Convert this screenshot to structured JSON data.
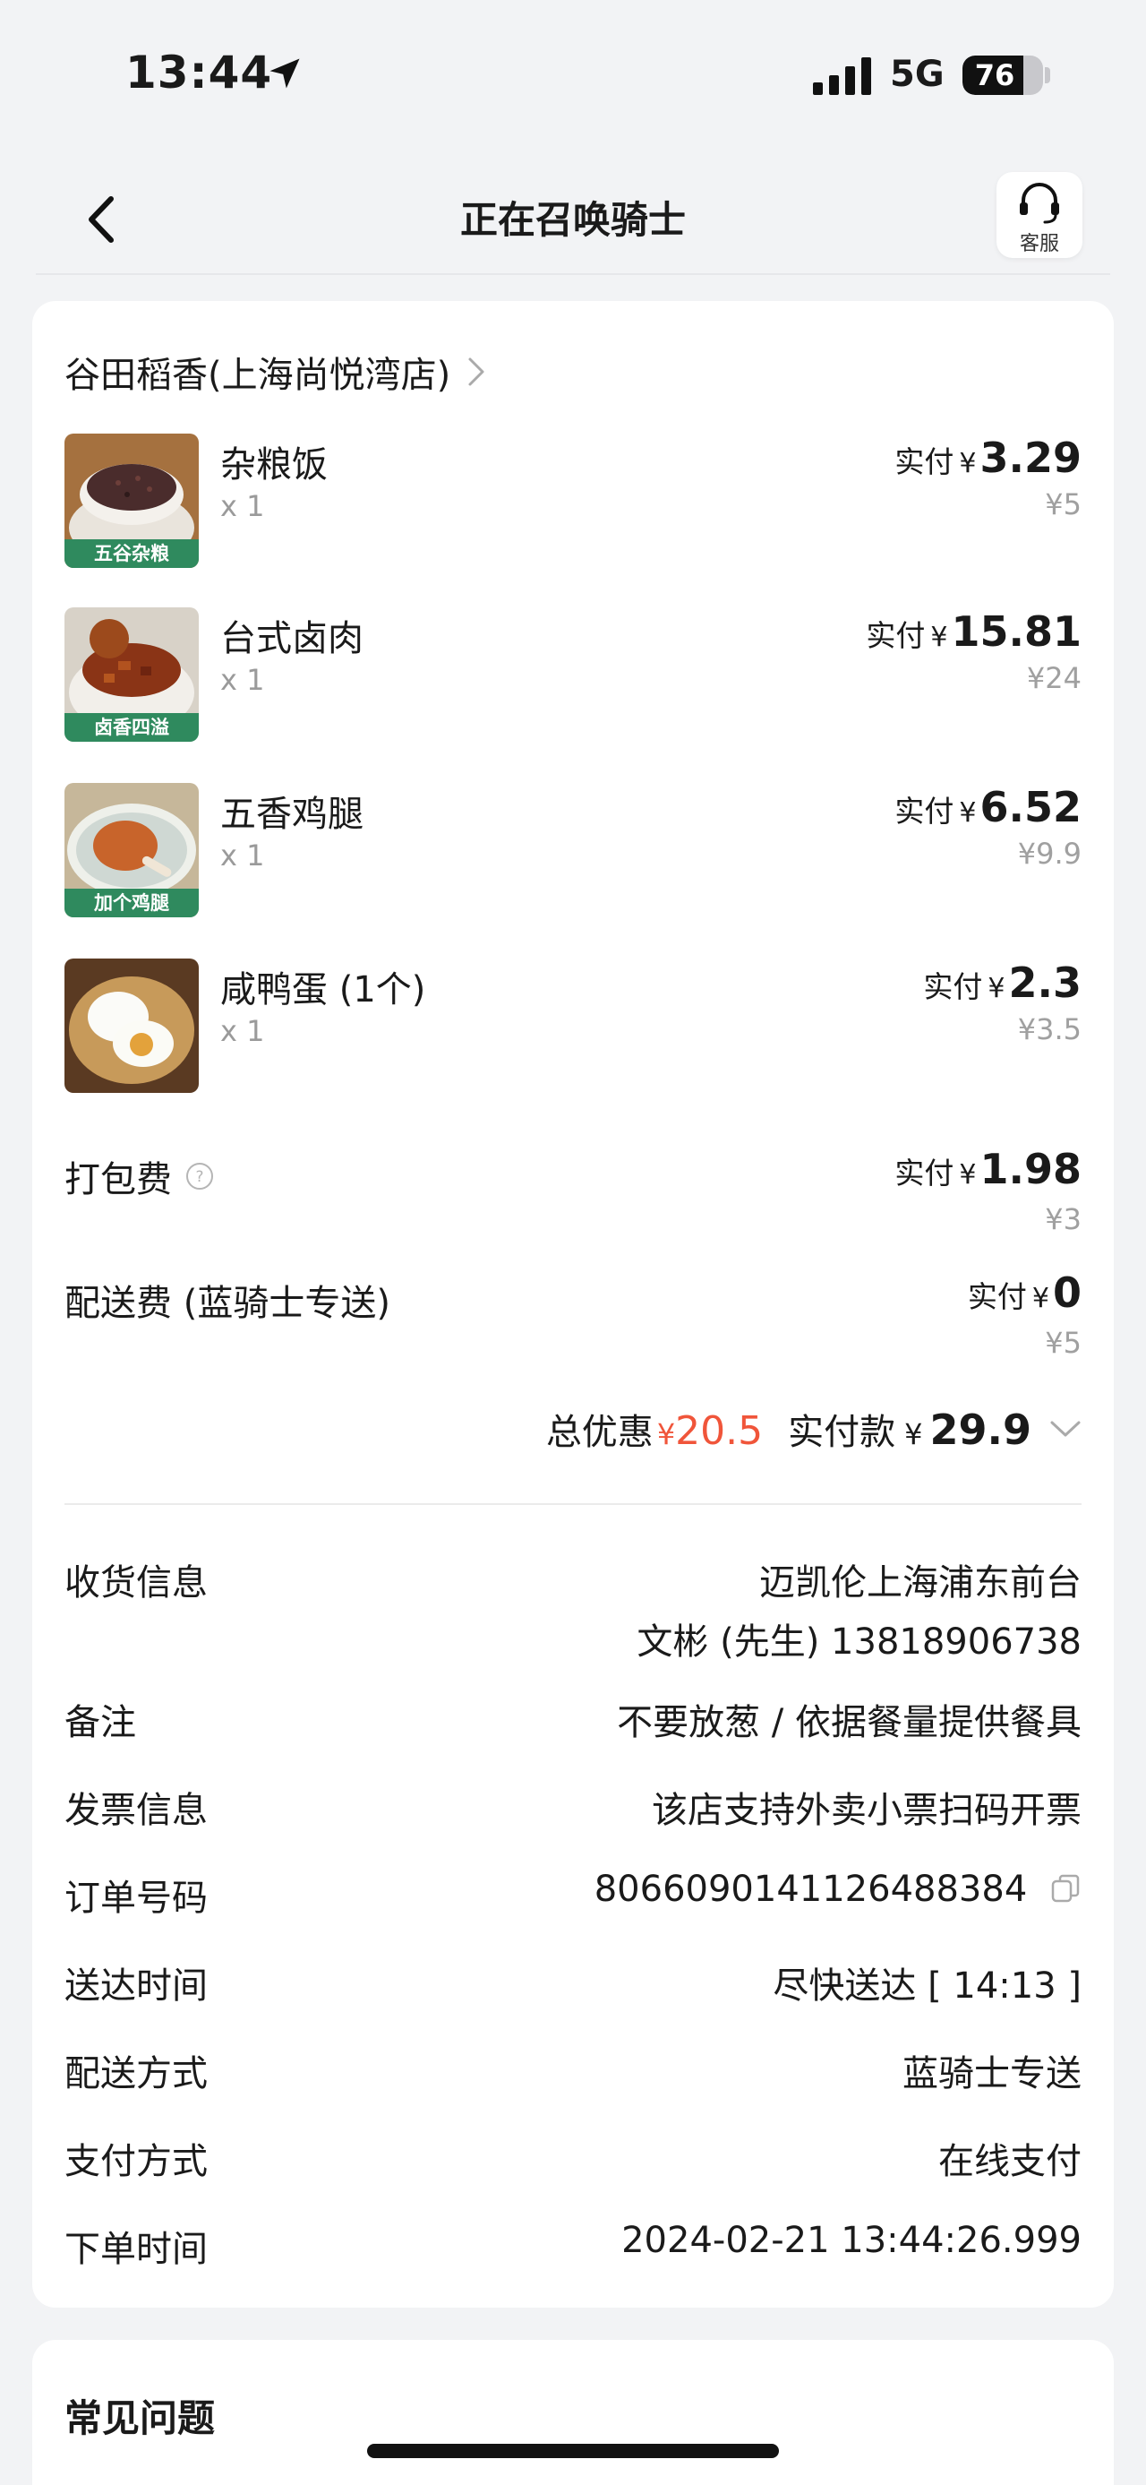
{
  "status_bar": {
    "time": "13:44",
    "network": "5G",
    "battery": "76",
    "battery_level": 0.76
  },
  "nav": {
    "title": "正在召唤骑士",
    "service_label": "客服"
  },
  "order": {
    "store_name": "谷田稻香(上海尚悦湾店)",
    "items": [
      {
        "name": "杂粮饭",
        "qty": "x 1",
        "pay_label": "实付",
        "pay_currency": "¥",
        "pay_value": "3.29",
        "original": "¥5",
        "image_caption": "五谷杂粮"
      },
      {
        "name": "台式卤肉",
        "qty": "x 1",
        "pay_label": "实付",
        "pay_currency": "¥",
        "pay_value": "15.81",
        "original": "¥24",
        "image_caption": "卤香四溢"
      },
      {
        "name": "五香鸡腿",
        "qty": "x 1",
        "pay_label": "实付",
        "pay_currency": "¥",
        "pay_value": "6.52",
        "original": "¥9.9",
        "image_caption": "加个鸡腿"
      },
      {
        "name": "咸鸭蛋 (1个)",
        "qty": "x 1",
        "pay_label": "实付",
        "pay_currency": "¥",
        "pay_value": "2.3",
        "original": "¥3.5",
        "image_caption": ""
      }
    ],
    "fees": [
      {
        "label": "打包费",
        "has_help": true,
        "pay_label": "实付",
        "pay_currency": "¥",
        "pay_value": "1.98",
        "original": "¥3"
      },
      {
        "label": "配送费 (蓝骑士专送)",
        "has_help": false,
        "pay_label": "实付",
        "pay_currency": "¥",
        "pay_value": "0",
        "original": "¥5"
      }
    ],
    "total": {
      "discount_label": "总优惠",
      "discount_currency": "¥",
      "discount_value": "20.5",
      "pay_label": "实付款",
      "pay_currency": "¥",
      "pay_value": "29.9"
    },
    "info": {
      "receiver_label": "收货信息",
      "receiver_address": "迈凯伦上海浦东前台",
      "receiver_contact": "文彬 (先生) 13818906738",
      "note_label": "备注",
      "note_value": "不要放葱 / 依据餐量提供餐具",
      "invoice_label": "发票信息",
      "invoice_value": "该店支持外卖小票扫码开票",
      "order_no_label": "订单号码",
      "order_no_value": "8066090141126488384",
      "delivery_time_label": "送达时间",
      "delivery_time_value": "尽快送达 [ 14:13 ]",
      "delivery_method_label": "配送方式",
      "delivery_method_value": "蓝骑士专送",
      "payment_method_label": "支付方式",
      "payment_method_value": "在线支付",
      "order_time_label": "下单时间",
      "order_time_value": "2024-02-21 13:44:26.999"
    }
  },
  "faq": {
    "title": "常见问题"
  },
  "colors": {
    "accent_red": "#f0553a",
    "caption_green": "#2f8a5e",
    "page_bg": "#f2f3f5"
  },
  "icons": [
    "location-arrow-icon",
    "signal-icon",
    "battery-icon",
    "back-icon",
    "headset-icon",
    "chevron-right-icon",
    "help-icon",
    "chevron-down-icon",
    "copy-icon"
  ]
}
